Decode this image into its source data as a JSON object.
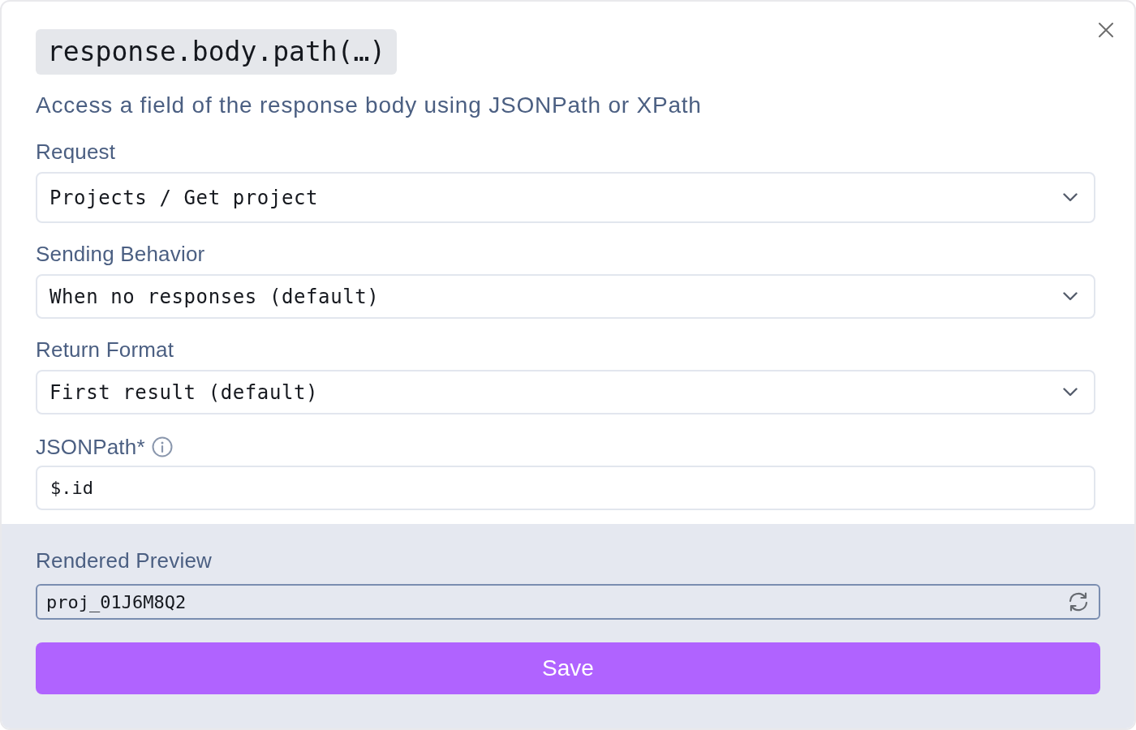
{
  "dialog": {
    "title": "response.body.path(…)",
    "description": "Access a field of the response body using JSONPath or XPath",
    "fields": [
      {
        "kind": "select",
        "label": "Request",
        "value": "Projects / Get project",
        "info": false
      },
      {
        "kind": "select",
        "label": "Sending Behavior",
        "value": "When no responses (default)",
        "info": false
      },
      {
        "kind": "select",
        "label": "Return Format",
        "value": "First result (default)",
        "info": false
      },
      {
        "kind": "text",
        "label": "JSONPath*",
        "value": "$.id",
        "info": true
      }
    ],
    "preview": {
      "label": "Rendered Preview",
      "value": "proj_01J6M8Q2"
    },
    "save_button": "Save"
  }
}
